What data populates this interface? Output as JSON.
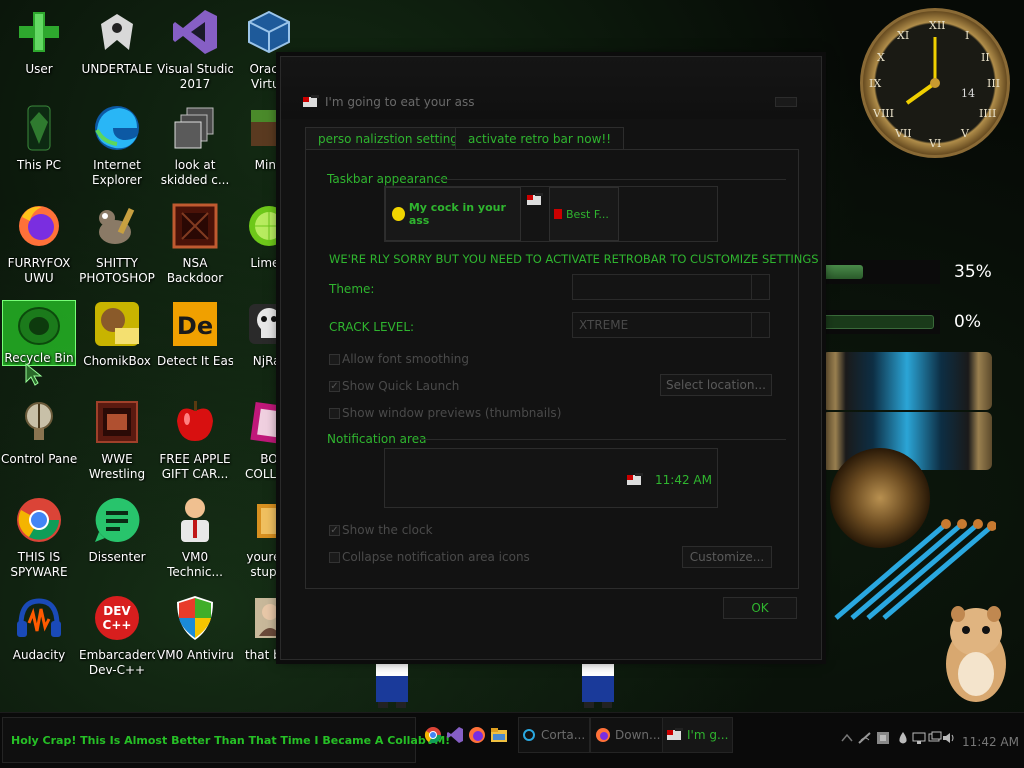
{
  "desktop": {
    "icons": [
      {
        "label": "User",
        "label2": "",
        "icon": "user-icon"
      },
      {
        "label": "UNDERTALE",
        "label2": "",
        "icon": "undertale-icon"
      },
      {
        "label": "Visual Studio",
        "label2": "2017",
        "icon": "visual-studio-icon"
      },
      {
        "label": "Oracle",
        "label2": "Virtua",
        "icon": "virtualbox-icon"
      },
      {
        "label": "This PC",
        "label2": "",
        "icon": "computer-icon"
      },
      {
        "label": "Internet",
        "label2": "Explorer",
        "icon": "edge-icon"
      },
      {
        "label": "look at",
        "label2": "skidded c...",
        "icon": "copies-icon"
      },
      {
        "label": "Mine",
        "label2": "",
        "icon": "minecraft-icon"
      },
      {
        "label": "FURRYFOX",
        "label2": "UWU",
        "icon": "firefox-icon"
      },
      {
        "label": "SHITTY",
        "label2": "PHOTOSHOP",
        "icon": "gimp-icon"
      },
      {
        "label": "NSA",
        "label2": "Backdoor",
        "icon": "backdoor-icon"
      },
      {
        "label": "LimeV",
        "label2": "",
        "icon": "lime-icon"
      },
      {
        "label": "Recycle Bin",
        "label2": "",
        "icon": "recycle-bin-icon"
      },
      {
        "label": "ChomikBox",
        "label2": "",
        "icon": "chomikbox-icon"
      },
      {
        "label": "Detect It Easy",
        "label2": "",
        "icon": "detect-it-easy-icon"
      },
      {
        "label": "NjRat",
        "label2": "",
        "icon": "skull-icon"
      },
      {
        "label": "Control Panel",
        "label2": "",
        "icon": "control-panel-icon"
      },
      {
        "label": "WWE",
        "label2": "Wrestling",
        "icon": "wwe-icon"
      },
      {
        "label": "FREE APPLE",
        "label2": "GIFT CAR...",
        "icon": "apple-icon"
      },
      {
        "label": "BO",
        "label2": "COLLAB",
        "icon": "bo-icon"
      },
      {
        "label": "THIS IS",
        "label2": "SPYWARE",
        "icon": "chrome-icon"
      },
      {
        "label": "Dissenter",
        "label2": "",
        "icon": "dissenter-icon"
      },
      {
        "label": "VM0",
        "label2": "Technic...",
        "icon": "technician-icon"
      },
      {
        "label": "youre a",
        "label2": "stupid",
        "icon": "folder-icon"
      },
      {
        "label": "Audacity",
        "label2": "",
        "icon": "audacity-icon"
      },
      {
        "label": "Embarcadero",
        "label2": "Dev-C++",
        "icon": "devcpp-icon"
      },
      {
        "label": "VM0 Antivirus",
        "label2": "",
        "icon": "antivirus-shield-icon"
      },
      {
        "label": "that but",
        "label2": "",
        "icon": "portrait-icon"
      }
    ]
  },
  "window": {
    "title": "I'm going to eat your ass",
    "tabs": [
      "perso nalizstion setting",
      "activate retro bar now!!"
    ],
    "taskbar_group": "Taskbar appearance",
    "preview_item_1": "My cock in your ass",
    "preview_item_2": "Best F...",
    "sorry_message": "WE'RE RLY SORRY BUT YOU NEED TO ACTIVATE RETROBAR TO CUSTOMIZE SETTINGS",
    "theme_label": "Theme:",
    "theme_value": "",
    "crack_label": "CRACK LEVEL:",
    "crack_value": "XTREME",
    "checkboxes": [
      {
        "label": "Allow font smoothing",
        "checked": false
      },
      {
        "label": "Show Quick Launch",
        "checked": true
      },
      {
        "label": "Show window previews (thumbnails)",
        "checked": false
      }
    ],
    "select_location": "Select location...",
    "notification_group": "Notification area",
    "notif_time": "11:42 AM",
    "checkboxes2": [
      {
        "label": "Show the clock",
        "checked": true
      },
      {
        "label": "Collapse notification area icons",
        "checked": false
      }
    ],
    "customize": "Customize...",
    "ok": "OK"
  },
  "taskbar": {
    "start_text": "Holy Crap! This Is Almost Better Than That Time I Became A CollabVM!",
    "items": [
      "Corta...",
      "Down...",
      "I'm g..."
    ],
    "clock": "11:42 AM"
  },
  "widgets": {
    "gauge1": "35%",
    "gauge1_level": 0.35,
    "gauge2": "0%",
    "gauge2_level": 0.0,
    "clock_numerals": [
      "XII",
      "I",
      "II",
      "III",
      "IIII",
      "V",
      "VI",
      "VII",
      "VIII",
      "IX",
      "X",
      "XI"
    ],
    "clock_date": "14",
    "accent": "#2fb52f",
    "start_text_color": "#26c026"
  }
}
